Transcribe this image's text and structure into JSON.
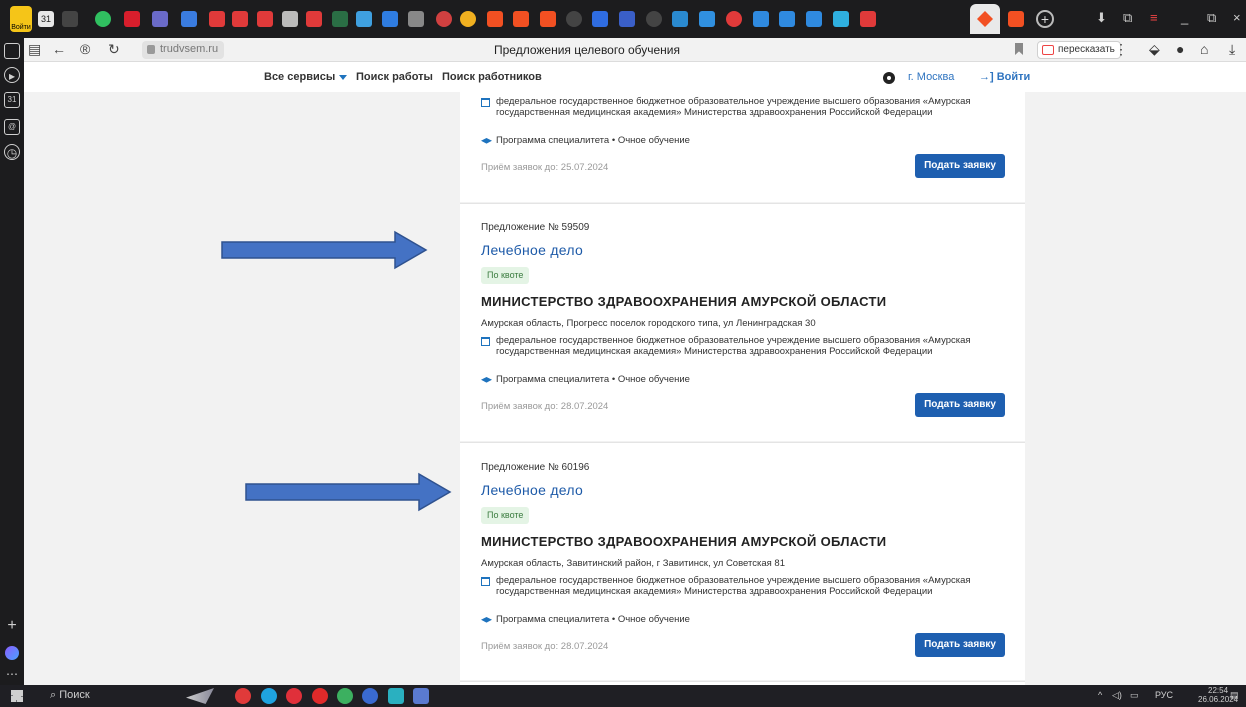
{
  "browser": {
    "yandex_button_label": "Войти",
    "tab_badge": "31",
    "url": "trudvsem.ru",
    "page_title": "Предложения целевого обучения",
    "retell_label": "пересказать",
    "sidebar_calendar_badge": "31"
  },
  "site_header": {
    "all_services": "Все сервисы",
    "job_search": "Поиск работы",
    "worker_search": "Поиск работников",
    "city": "г. Москва",
    "login": "Войти"
  },
  "offers": [
    {
      "number": "",
      "specialty": "",
      "quota": "",
      "organization": "",
      "address": "",
      "institution": "федеральное государственное бюджетное образовательное учреждение высшего образования «Амурская государственная медицинская академия» Министерства здравоохранения Российской Федерации",
      "program": "Программа специалитета • Очное обучение",
      "deadline": "Приём заявок до: 25.07.2024",
      "apply_label": "Подать заявку"
    },
    {
      "number": "Предложение № 59509",
      "specialty": "Лечебное дело",
      "quota": "По квоте",
      "organization": "МИНИСТЕРСТВО ЗДРАВООХРАНЕНИЯ АМУРСКОЙ ОБЛАСТИ",
      "address": "Амурская область, Прогресс поселок городского типа, ул Ленинградская 30",
      "institution": "федеральное государственное бюджетное образовательное учреждение высшего образования «Амурская государственная медицинская академия» Министерства здравоохранения Российской Федерации",
      "program": "Программа специалитета • Очное обучение",
      "deadline": "Приём заявок до: 28.07.2024",
      "apply_label": "Подать заявку"
    },
    {
      "number": "Предложение № 60196",
      "specialty": "Лечебное дело",
      "quota": "По квоте",
      "organization": "МИНИСТЕРСТВО ЗДРАВООХРАНЕНИЯ АМУРСКОЙ ОБЛАСТИ",
      "address": "Амурская область, Завитинский район, г Завитинск, ул Советская 81",
      "institution": "федеральное государственное бюджетное образовательное учреждение высшего образования «Амурская государственная медицинская академия» Министерства здравоохранения Российской Федерации",
      "program": "Программа специалитета • Очное обучение",
      "deadline": "Приём заявок до: 28.07.2024",
      "apply_label": "Подать заявку"
    }
  ],
  "taskbar": {
    "search_label": "Поиск",
    "language": "РУС",
    "time": "22:54",
    "date": "26.06.2024"
  },
  "colors": {
    "accent": "#1e5fb0",
    "link": "#1d5aa8",
    "quota_bg": "#e4f4e5",
    "arrow_fill": "#4472c4",
    "arrow_stroke": "#2f528f"
  }
}
